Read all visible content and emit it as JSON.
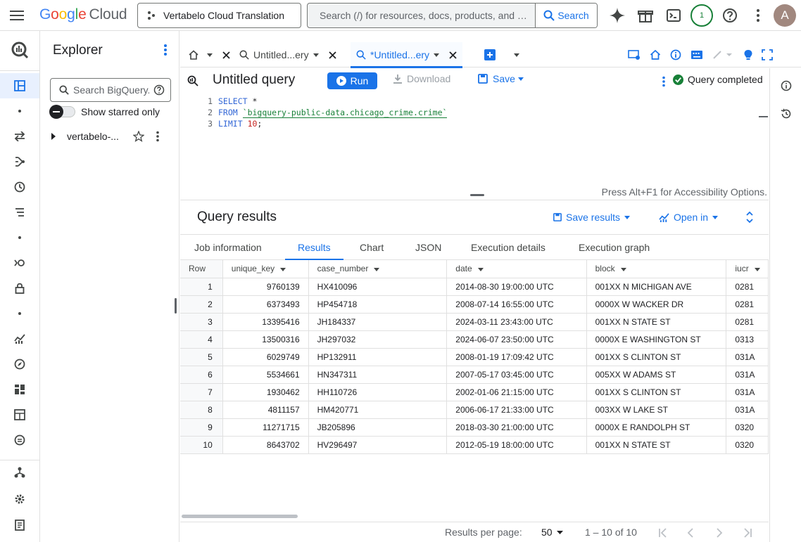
{
  "topbar": {
    "logo": {
      "g": "G",
      "o1": "o",
      "o2": "o",
      "g2": "g",
      "l": "l",
      "e": "e",
      "cloud": "Cloud"
    },
    "project_name": "Vertabelo Cloud Translation",
    "search_placeholder": "Search (/) for resources, docs, products, and mo...",
    "search_button": "Search",
    "notifications_count": "1",
    "avatar_letter": "A"
  },
  "explorer": {
    "title": "Explorer",
    "search_placeholder": "Search BigQuery...",
    "show_starred_label": "Show starred only",
    "tree_item": "vertabelo-..."
  },
  "tabs": [
    {
      "label": "Untitled...ery"
    },
    {
      "label": "*Untitled...ery"
    }
  ],
  "query": {
    "title": "Untitled query",
    "run_label": "Run",
    "download_label": "Download",
    "save_label": "Save",
    "status_label": "Query completed",
    "lines": [
      "1",
      "2",
      "3"
    ],
    "code": {
      "kw1": "SELECT",
      "l1_rest": " *",
      "kw2": "FROM",
      "table": "`bigquery-public-data.chicago_crime.crime`",
      "kw3": "LIMIT",
      "limit_value": "10",
      "semicolon": ";"
    },
    "accessibility_hint": "Press Alt+F1 for Accessibility Options."
  },
  "results": {
    "title": "Query results",
    "save_results_label": "Save results",
    "open_in_label": "Open in",
    "tabs": [
      "Job information",
      "Results",
      "Chart",
      "JSON",
      "Execution details",
      "Execution graph"
    ],
    "columns": [
      "Row",
      "unique_key",
      "case_number",
      "date",
      "block",
      "iucr"
    ],
    "rows": [
      [
        "1",
        "9760139",
        "HX410096",
        "2014-08-30 19:00:00 UTC",
        "001XX N MICHIGAN AVE",
        "0281"
      ],
      [
        "2",
        "6373493",
        "HP454718",
        "2008-07-14 16:55:00 UTC",
        "0000X W WACKER DR",
        "0281"
      ],
      [
        "3",
        "13395416",
        "JH184337",
        "2024-03-11 23:43:00 UTC",
        "001XX N STATE ST",
        "0281"
      ],
      [
        "4",
        "13500316",
        "JH297032",
        "2024-06-07 23:50:00 UTC",
        "0000X E WASHINGTON ST",
        "0313"
      ],
      [
        "5",
        "6029749",
        "HP132911",
        "2008-01-19 17:09:42 UTC",
        "001XX S CLINTON ST",
        "031A"
      ],
      [
        "6",
        "5534661",
        "HN347311",
        "2007-05-17 03:45:00 UTC",
        "005XX W ADAMS ST",
        "031A"
      ],
      [
        "7",
        "1930462",
        "HH110726",
        "2002-01-06 21:15:00 UTC",
        "001XX S CLINTON ST",
        "031A"
      ],
      [
        "8",
        "4811157",
        "HM420771",
        "2006-06-17 21:33:00 UTC",
        "003XX W LAKE ST",
        "031A"
      ],
      [
        "9",
        "11271715",
        "JB205896",
        "2018-03-30 21:00:00 UTC",
        "0000X E RANDOLPH ST",
        "0320"
      ],
      [
        "10",
        "8643702",
        "HV296497",
        "2012-05-19 18:00:00 UTC",
        "001XX N STATE ST",
        "0320"
      ]
    ],
    "pager": {
      "per_page_label": "Results per page:",
      "per_page_value": "50",
      "range": "1 – 10 of 10"
    }
  },
  "colors": {
    "accent": "#1a73e8",
    "success": "#188038"
  }
}
